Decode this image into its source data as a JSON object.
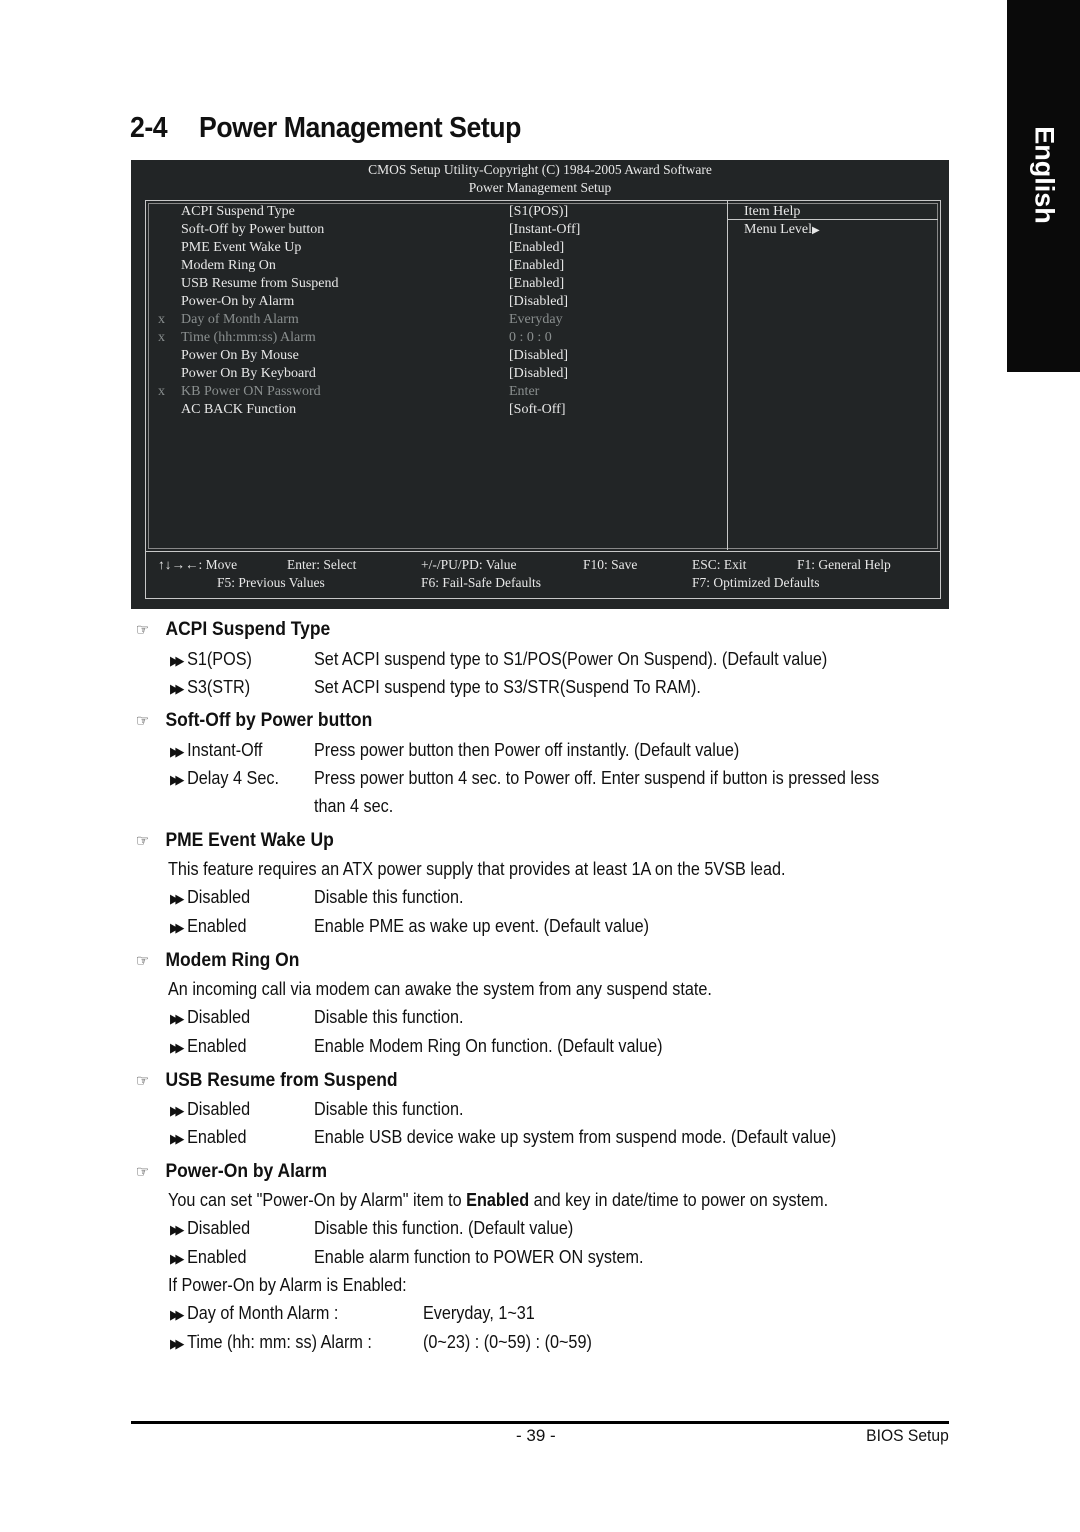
{
  "side_tab": {
    "label": "English"
  },
  "heading": {
    "number": "2-4",
    "title": "Power Management Setup"
  },
  "bios": {
    "header_line1": "CMOS Setup Utility-Copyright (C) 1984-2005 Award Software",
    "header_line2": "Power Management Setup",
    "items": [
      {
        "disabled_mark": "",
        "label": "ACPI Suspend Type",
        "value": "[S1(POS)]",
        "dim": false
      },
      {
        "disabled_mark": "",
        "label": "Soft-Off by Power button",
        "value": "[Instant-Off]",
        "dim": false
      },
      {
        "disabled_mark": "",
        "label": "PME Event Wake Up",
        "value": "[Enabled]",
        "dim": false
      },
      {
        "disabled_mark": "",
        "label": "Modem Ring On",
        "value": "[Enabled]",
        "dim": false
      },
      {
        "disabled_mark": "",
        "label": "USB Resume from Suspend",
        "value": "[Enabled]",
        "dim": false
      },
      {
        "disabled_mark": "",
        "label": "Power-On by Alarm",
        "value": "[Disabled]",
        "dim": false
      },
      {
        "disabled_mark": "x",
        "label": "Day of Month Alarm",
        "value": "Everyday",
        "dim": true
      },
      {
        "disabled_mark": "x",
        "label": "Time (hh:mm:ss) Alarm",
        "value": "0 : 0 : 0",
        "dim": true
      },
      {
        "disabled_mark": "",
        "label": "Power On By Mouse",
        "value": "[Disabled]",
        "dim": false
      },
      {
        "disabled_mark": "",
        "label": "Power On By Keyboard",
        "value": "[Disabled]",
        "dim": false
      },
      {
        "disabled_mark": "x",
        "label": "KB Power ON Password",
        "value": "Enter",
        "dim": true
      },
      {
        "disabled_mark": "",
        "label": "AC BACK Function",
        "value": "[Soft-Off]",
        "dim": false
      }
    ],
    "help_title": "Item Help",
    "help_menu_level": "Menu Level",
    "help_arrow_icon": "▶",
    "keys": {
      "move": "↑↓→←: Move",
      "select": "Enter: Select",
      "value": "+/-/PU/PD: Value",
      "save": "F10: Save",
      "exit": "ESC: Exit",
      "help": "F1: General Help",
      "prev": "F5: Previous Values",
      "failsafe": "F6: Fail-Safe Defaults",
      "optimized": "F7: Optimized Defaults"
    }
  },
  "sections": {
    "hand_icon": "☞",
    "option_arrow": "▶▶",
    "acpi": {
      "title": "ACPI Suspend Type",
      "options": [
        {
          "name": "S1(POS)",
          "desc": "Set ACPI suspend type to S1/POS(Power On Suspend). (Default value)"
        },
        {
          "name": "S3(STR)",
          "desc": "Set ACPI suspend type to S3/STR(Suspend To RAM)."
        }
      ]
    },
    "softoff": {
      "title": "Soft-Off by Power button",
      "options": [
        {
          "name": "Instant-Off",
          "desc": "Press power button then Power off instantly. (Default value)"
        },
        {
          "name": "Delay 4 Sec.",
          "desc": "Press power button 4 sec. to Power off. Enter suspend if button is pressed less",
          "desc2": "than 4 sec."
        }
      ]
    },
    "pme": {
      "title": "PME Event Wake Up",
      "intro": "This feature requires an ATX power supply that provides at least 1A on the 5VSB lead.",
      "options": [
        {
          "name": "Disabled",
          "desc": "Disable this function."
        },
        {
          "name": "Enabled",
          "desc": "Enable PME as wake up event. (Default value)"
        }
      ]
    },
    "modem": {
      "title": "Modem Ring On",
      "intro": "An incoming call via modem can awake the system from any suspend state.",
      "options": [
        {
          "name": "Disabled",
          "desc": "Disable this function."
        },
        {
          "name": "Enabled",
          "desc": "Enable Modem Ring On function. (Default value)"
        }
      ]
    },
    "usb": {
      "title": "USB Resume from Suspend",
      "options": [
        {
          "name": "Disabled",
          "desc": "Disable this function."
        },
        {
          "name": "Enabled",
          "desc": "Enable USB device wake up system from suspend mode. (Default value)"
        }
      ]
    },
    "alarm": {
      "title": "Power-On by Alarm",
      "intro_pre": "You can set \"Power-On by Alarm\" item to ",
      "intro_bold": "Enabled",
      "intro_post": " and key in date/time to power on system.",
      "options": [
        {
          "name": "Disabled",
          "desc": "Disable this function. (Default value)"
        },
        {
          "name": "Enabled",
          "desc": "Enable alarm function to POWER ON system."
        }
      ],
      "if_enabled": "If Power-On by Alarm is Enabled:",
      "sub": [
        {
          "name": "Day of Month Alarm :",
          "desc": "Everyday, 1~31"
        },
        {
          "name": "Time (hh: mm: ss) Alarm :",
          "desc": "(0~23) : (0~59) : (0~59)"
        }
      ]
    }
  },
  "footer": {
    "page": "- 39 -",
    "label": "BIOS Setup"
  }
}
